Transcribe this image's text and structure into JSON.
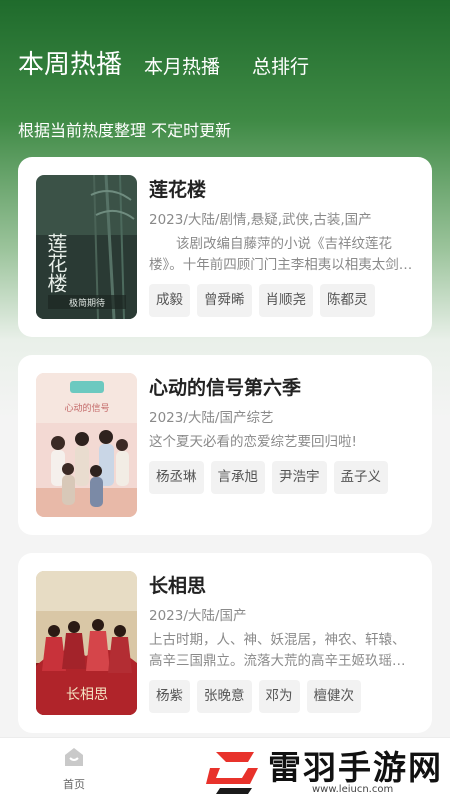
{
  "tabs": [
    "本周热播",
    "本月热播",
    "总排行"
  ],
  "subtitle": "根据当前热度整理 不定时更新",
  "shows": [
    {
      "title": "莲花楼",
      "meta": "2023/大陆/剧情,悬疑,武侠,古装,国产",
      "desc": "该剧改编自藤萍的小说《吉祥纹莲花楼》。十年前四顾门门主李相夷以相夷太剑名动江湖，东海一战后销声匿迹。",
      "cast": [
        "成毅",
        "曾舜晞",
        "肖顺尧",
        "陈都灵"
      ],
      "poster_text": "莲花楼",
      "poster_caption": "极简期待"
    },
    {
      "title": "心动的信号第六季",
      "meta": "2023/大陆/国产综艺",
      "desc": "这个夏天必看的恋爱综艺要回归啦!",
      "cast": [
        "杨丞琳",
        "言承旭",
        "尹浩宇",
        "孟子义"
      ],
      "poster_text": "心动的信号"
    },
    {
      "title": "长相思",
      "meta": "2023/大陆/国产",
      "desc": "上古时期，人、神、妖混居，神农、轩辕、高辛三国鼎立。流落大荒的高辛王姬玖瑶，以小夭之名辗转世间。",
      "cast": [
        "杨紫",
        "张晚意",
        "邓为",
        "檀健次"
      ],
      "poster_text": "长相思"
    }
  ],
  "nav": {
    "home_label": "首页"
  },
  "watermark": {
    "text": "雷羽手游网",
    "url": "www.leiucn.com"
  }
}
